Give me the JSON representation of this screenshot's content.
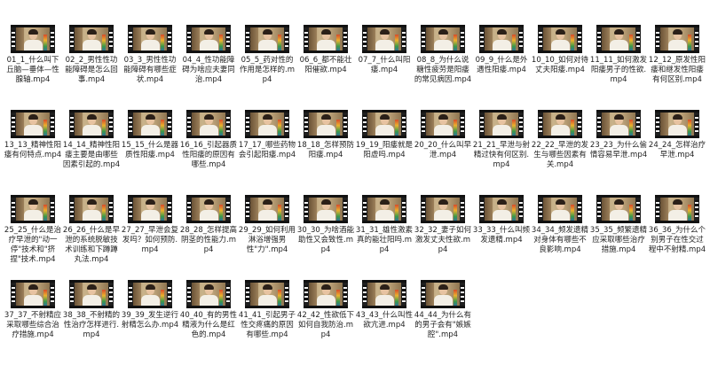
{
  "files": [
    "01_1_什么叫下丘脑—垂体—性腺轴.mp4",
    "02_2_男性性功能障碍是怎么回事.mp4",
    "03_3_男性性功能障碍有哪些症状.mp4",
    "04_4_性功能障碍为啥应夫妻同治.mp4",
    "05_5_药对性的作用是怎样的.mp4",
    "06_6_都不能壮阳催欲.mp4",
    "07_7_什么叫阳痿.mp4",
    "08_8_为什么说糖性疲劳是阳痿的常见病因.mp4",
    "09_9_什么是外遇性阳痿.mp4",
    "10_10_如何对待丈夫阳痿.mp4",
    "11_11_如何激发阳痿男子的性欲.mp4",
    "12_12_原发性阳痿和继发性阳痿有何区别.mp4",
    "13_13_精神性阳痿有何特点.mp4",
    "14_14_精神性阳痿主要是由哪些因素引起的.mp4",
    "15_15_什么是器质性阳痿.mp4",
    "16_16_引起器质性阳痿的原因有哪些.mp4",
    "17_17_哪些药物会引起阳痿.mp4",
    "18_18_怎样预防阳痿.mp4",
    "19_19_阳痿就是阳虚吗.mp4",
    "20_20_什么叫早泄.mp4",
    "21_21_早泄与射精过快有何区别.mp4",
    "22_22_早泄的发生与哪些因素有关.mp4",
    "23_23_为什么偷情容易早泄.mp4",
    "24_24_怎样治疗早泄.mp4",
    "25_25_什么是治疗早泄的\"动一停\"技术和\"挤捏\"技术.mp4",
    "26_26_什么是早泄的系统脱敏技术训练和下蹲蹲丸法.mp4",
    "27_27_早泄会复发吗？如何预防.mp4",
    "28_28_怎样提高阴茎的性能力.mp4",
    "29_29_如何利用淋浴增强男性\"力\".mp4",
    "30_30_为啥酒能助性又会致性.mp4",
    "31_31_雄性激素真的能壮阳吗.mp4",
    "32_32_妻子如何激发丈夫性欲.mp4",
    "33_33_什么叫频发遗精.mp4",
    "34_34_频发遗精对身体有哪些不良影响.mp4",
    "35_35_频繁遗精应采取哪些治疗措施.mp4",
    "36_36_为什么个别男子在性交过程中不射精.mp4",
    "37_37_不射精应采取哪些综合治疗措施.mp4",
    "38_38_不射精的性治疗怎样进行.mp4",
    "39_39_发生逆行射精怎么办.mp4",
    "40_40_有的男性精液为什么是红色的.mp4",
    "41_41_引起男子性交疼痛的原因有哪些.mp4",
    "42_42_性欲低下如何自我防治.mp4",
    "43_43_什么叫性欲亢进.mp4",
    "44_44_为什么有的男子会有\"嫉嫉腔\".mp4"
  ]
}
